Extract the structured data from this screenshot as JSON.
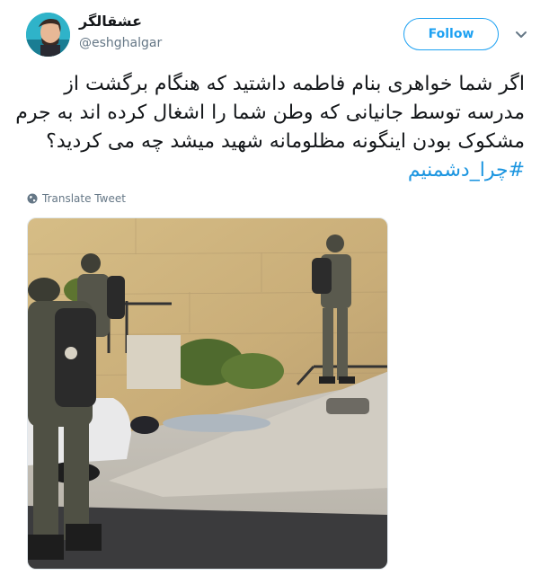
{
  "user": {
    "display_name": "عشقالگر",
    "handle": "@eshghalgar"
  },
  "follow_button": {
    "label": "Follow"
  },
  "tweet": {
    "lines": [
      "اگر شما خواهری بنام فاطمه داشتید که هنگام برگشت از",
      "مدرسه توسط جانیانی که وطن شما را اشغال کرده اند به جرم",
      "مشکوک بودن اینگونه مظلومانه شهید میشد چه می کردید؟"
    ],
    "hashtag": "#چرا_دشمنیم"
  },
  "translate_link": {
    "label": "Translate Tweet"
  },
  "icons": {
    "more": "chevron-down-icon",
    "translate": "globe-icon"
  },
  "colors": {
    "accent": "#1da1f2",
    "hashtag": "#1b95e0",
    "secondary_text": "#657786"
  }
}
